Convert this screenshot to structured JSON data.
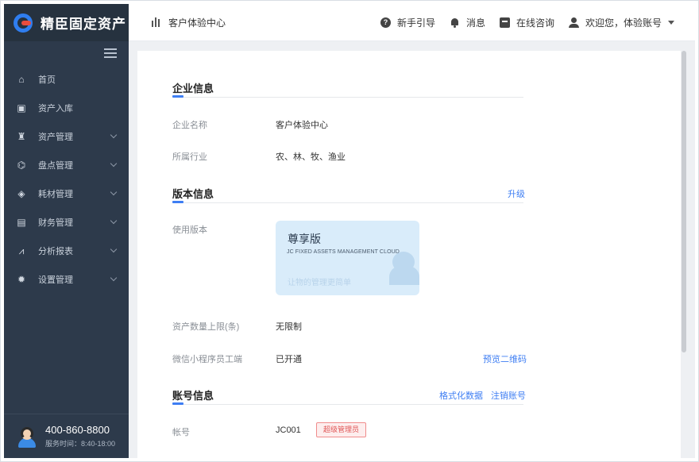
{
  "app": {
    "name": "精臣固定资产"
  },
  "sidebar": {
    "items": [
      {
        "label": "首页",
        "icon": "home-icon",
        "has_children": false
      },
      {
        "label": "资产入库",
        "icon": "inbox-icon",
        "has_children": false
      },
      {
        "label": "资产管理",
        "icon": "asset-icon",
        "has_children": true
      },
      {
        "label": "盘点管理",
        "icon": "inventory-icon",
        "has_children": true
      },
      {
        "label": "耗材管理",
        "icon": "consumables-icon",
        "has_children": true
      },
      {
        "label": "财务管理",
        "icon": "finance-icon",
        "has_children": true
      },
      {
        "label": "分析报表",
        "icon": "report-icon",
        "has_children": true
      },
      {
        "label": "设置管理",
        "icon": "settings-icon",
        "has_children": true
      }
    ],
    "phone": "400-860-8800",
    "service_time": "服务时间：8:40-18:00"
  },
  "topbar": {
    "breadcrumb": "客户体验中心",
    "guide": "新手引导",
    "messages": "消息",
    "consult": "在线咨询",
    "welcome": "欢迎您，体验账号"
  },
  "enterprise": {
    "title": "企业信息",
    "name_label": "企业名称",
    "name_value": "客户体验中心",
    "industry_label": "所属行业",
    "industry_value": "农、林、牧、渔业"
  },
  "version": {
    "title": "版本信息",
    "upgrade": "升级",
    "used_label": "使用版本",
    "card_title": "尊享版",
    "card_sub": "JC FIXED ASSETS MANAGEMENT CLOUD",
    "card_slogan": "让物的管理更简单",
    "limit_label": "资产数量上限(条)",
    "limit_value": "无限制",
    "wechat_label": "微信小程序员工端",
    "wechat_value": "已开通",
    "qr_link": "预览二维码"
  },
  "account": {
    "title": "账号信息",
    "format_link": "格式化数据",
    "cancel_link": "注销账号",
    "account_label": "帐号",
    "account_value": "JC001",
    "role_badge": "超级管理员"
  },
  "colors": {
    "sidebar_bg": "#2d3a4b",
    "accent": "#3e7ef3",
    "badge_red": "#e05555"
  }
}
